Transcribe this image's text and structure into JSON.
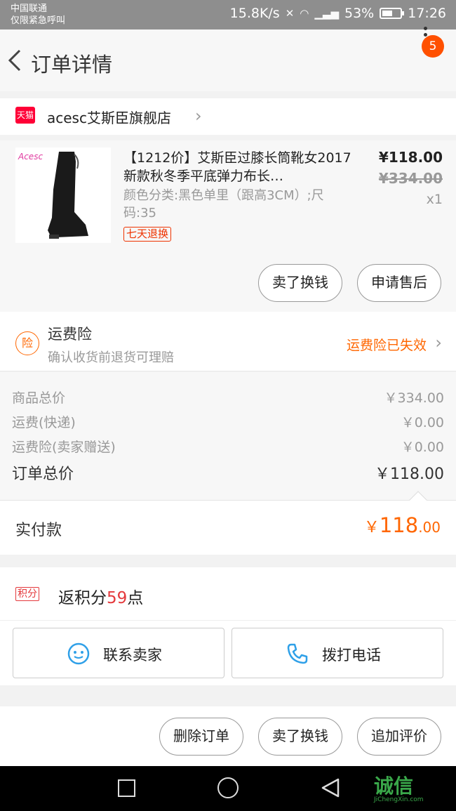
{
  "status_bar": {
    "carrier_line1": "中国联通",
    "carrier_line2": "仅限紧急呼叫",
    "net_speed": "15.8K/s",
    "battery": "53%",
    "time": "17:26"
  },
  "header": {
    "title": "订单详情",
    "message_badge": "5",
    "icons": [
      "chevron-left-icon",
      "more-vertical-icon"
    ]
  },
  "shop": {
    "platform_label": "天猫",
    "name": "acesc艾斯臣旗舰店"
  },
  "item": {
    "brand_mark": "Acesc",
    "title": "【1212价】艾斯臣过膝长筒靴女2017新款秋冬季平底弹力布长…",
    "spec": "颜色分类:黑色单里（跟高3CM）;尺码:35",
    "return_tag": "七天退换",
    "price": "¥118.00",
    "original_price": "¥334.00",
    "quantity": "x1"
  },
  "item_actions": {
    "sell_exchange": "卖了换钱",
    "after_sale": "申请售后"
  },
  "insurance": {
    "icon_char": "险",
    "title": "运费险",
    "subtitle": "确认收货前退货可理赔",
    "status": "运费险已失效"
  },
  "summary": {
    "rows": [
      {
        "label": "商品总价",
        "value": "￥334.00"
      },
      {
        "label": "运费(快递)",
        "value": "￥0.00"
      },
      {
        "label": "运费险(卖家赠送)",
        "value": "￥0.00"
      }
    ],
    "total_label": "订单总价",
    "total_value": "￥118.00"
  },
  "payment": {
    "label": "实付款",
    "currency": "￥",
    "integer": "118",
    "decimal": ".00"
  },
  "points": {
    "tag": "积分",
    "prefix": "返积分",
    "value": "59",
    "suffix": "点"
  },
  "contact": {
    "seller_label": "联系卖家",
    "phone_label": "拨打电话"
  },
  "bottom_actions": {
    "delete_order": "删除订单",
    "sell_exchange": "卖了换钱",
    "add_review": "追加评价"
  },
  "watermark": {
    "text": "诚信",
    "sub": "JiChengXin.com"
  },
  "colors": {
    "accent": "#ff6600",
    "badge": "#ff5000",
    "points_red": "#e4393c",
    "tmall_red": "#ff0036"
  }
}
